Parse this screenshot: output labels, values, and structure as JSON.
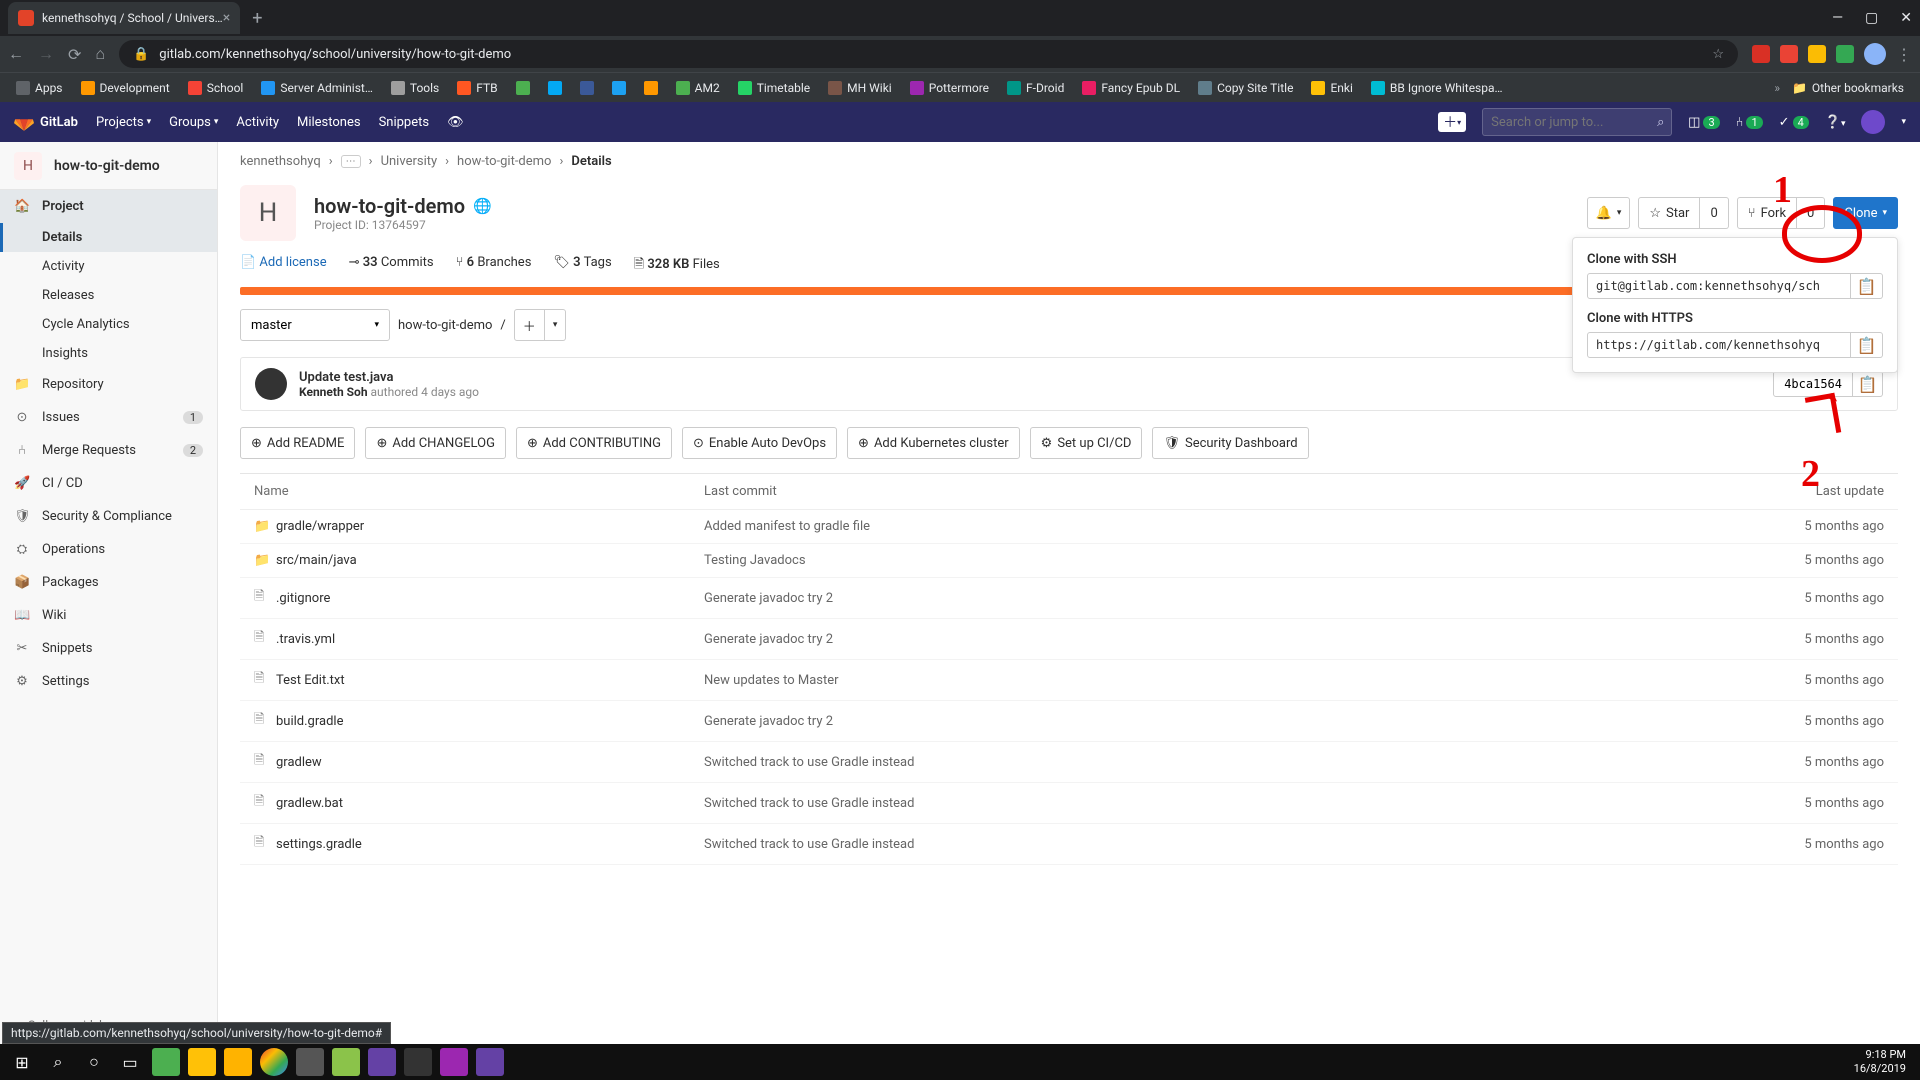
{
  "browser": {
    "tab_title": "kennethsohyq / School / Univers…",
    "url": "gitlab.com/kennethsohyq/school/university/how-to-git-demo",
    "bookmarks": [
      "Apps",
      "Development",
      "School",
      "Server Administ…",
      "Tools",
      "FTB",
      "",
      "",
      "",
      "",
      "",
      "AM2",
      "Timetable",
      "MH Wiki",
      "Pottermore",
      "F-Droid",
      "Fancy Epub DL",
      "Copy Site Title",
      "Enki",
      "BB Ignore Whitespa…"
    ],
    "other_bookmarks": "Other bookmarks",
    "status_hint": "https://gitlab.com/kennethsohyq/school/university/how-to-git-demo#"
  },
  "gl_nav": {
    "brand": "GitLab",
    "items": [
      "Projects",
      "Groups",
      "Activity",
      "Milestones",
      "Snippets"
    ],
    "search_placeholder": "Search or jump to...",
    "counts": {
      "d": "3",
      "issues": "1",
      "todos": "4"
    }
  },
  "sidebar": {
    "project_char": "H",
    "project_name": "how-to-git-demo",
    "items": [
      {
        "icon": "🏠",
        "label": "Project",
        "active": true,
        "subs": [
          {
            "label": "Details",
            "active": true
          },
          {
            "label": "Activity"
          },
          {
            "label": "Releases"
          },
          {
            "label": "Cycle Analytics"
          },
          {
            "label": "Insights"
          }
        ]
      },
      {
        "icon": "📁",
        "label": "Repository"
      },
      {
        "icon": "⊙",
        "label": "Issues",
        "count": "1"
      },
      {
        "icon": "⑃",
        "label": "Merge Requests",
        "count": "2"
      },
      {
        "icon": "🚀",
        "label": "CI / CD"
      },
      {
        "icon": "🛡",
        "label": "Security & Compliance"
      },
      {
        "icon": "⛭",
        "label": "Operations"
      },
      {
        "icon": "📦",
        "label": "Packages"
      },
      {
        "icon": "📖",
        "label": "Wiki"
      },
      {
        "icon": "✂",
        "label": "Snippets"
      },
      {
        "icon": "⚙",
        "label": "Settings"
      }
    ],
    "collapse": "Collapse sidebar"
  },
  "crumbs": [
    "kennethsohyq",
    "⋯",
    "University",
    "how-to-git-demo",
    "Details"
  ],
  "project": {
    "avatar_char": "H",
    "title": "how-to-git-demo",
    "visibility": "🌐",
    "id_label": "Project ID: 13764597",
    "star": "Star",
    "star_count": "0",
    "fork": "Fork",
    "fork_count": "0",
    "clone": "Clone"
  },
  "clone_drop": {
    "ssh_label": "Clone with SSH",
    "ssh_url": "git@gitlab.com:kennethsohyq/sch",
    "https_label": "Clone with HTTPS",
    "https_url": "https://gitlab.com/kennethsohyq"
  },
  "meta": {
    "add_license": "Add license",
    "commits_n": "33",
    "commits_l": "Commits",
    "branches_n": "6",
    "branches_l": "Branches",
    "tags_n": "3",
    "tags_l": "Tags",
    "size_n": "328 KB",
    "size_l": "Files"
  },
  "branch": {
    "selected": "master",
    "path": "how-to-git-demo",
    "sep": "/"
  },
  "last_commit": {
    "title": "Update test.java",
    "author": "Kenneth Soh",
    "verb": "authored",
    "time": "4 days ago",
    "sha": "4bca1564"
  },
  "action_buttons": [
    "Add README",
    "Add CHANGELOG",
    "Add CONTRIBUTING",
    "Enable Auto DevOps",
    "Add Kubernetes cluster",
    "Set up CI/CD",
    "Security Dashboard"
  ],
  "table": {
    "head": {
      "name": "Name",
      "commit": "Last commit",
      "update": "Last update"
    },
    "rows": [
      {
        "type": "dir",
        "name": "gradle/wrapper",
        "commit": "Added manifest to gradle file",
        "update": "5 months ago"
      },
      {
        "type": "dir",
        "name": "src/main/java",
        "commit": "Testing Javadocs",
        "update": "5 months ago"
      },
      {
        "type": "file",
        "name": ".gitignore",
        "commit": "Generate javadoc try 2",
        "update": "5 months ago"
      },
      {
        "type": "file",
        "name": ".travis.yml",
        "commit": "Generate javadoc try 2",
        "update": "5 months ago"
      },
      {
        "type": "file",
        "name": "Test Edit.txt",
        "commit": "New updates to Master",
        "update": "5 months ago"
      },
      {
        "type": "file",
        "name": "build.gradle",
        "commit": "Generate javadoc try 2",
        "update": "5 months ago"
      },
      {
        "type": "file",
        "name": "gradlew",
        "commit": "Switched track to use Gradle instead",
        "update": "5 months ago"
      },
      {
        "type": "file",
        "name": "gradlew.bat",
        "commit": "Switched track to use Gradle instead",
        "update": "5 months ago"
      },
      {
        "type": "file",
        "name": "settings.gradle",
        "commit": "Switched track to use Gradle instead",
        "update": "5 months ago"
      }
    ]
  },
  "taskbar": {
    "time": "9:18 PM",
    "date": "16/8/2019"
  },
  "annotations": {
    "n1": "1",
    "n2": "2"
  }
}
